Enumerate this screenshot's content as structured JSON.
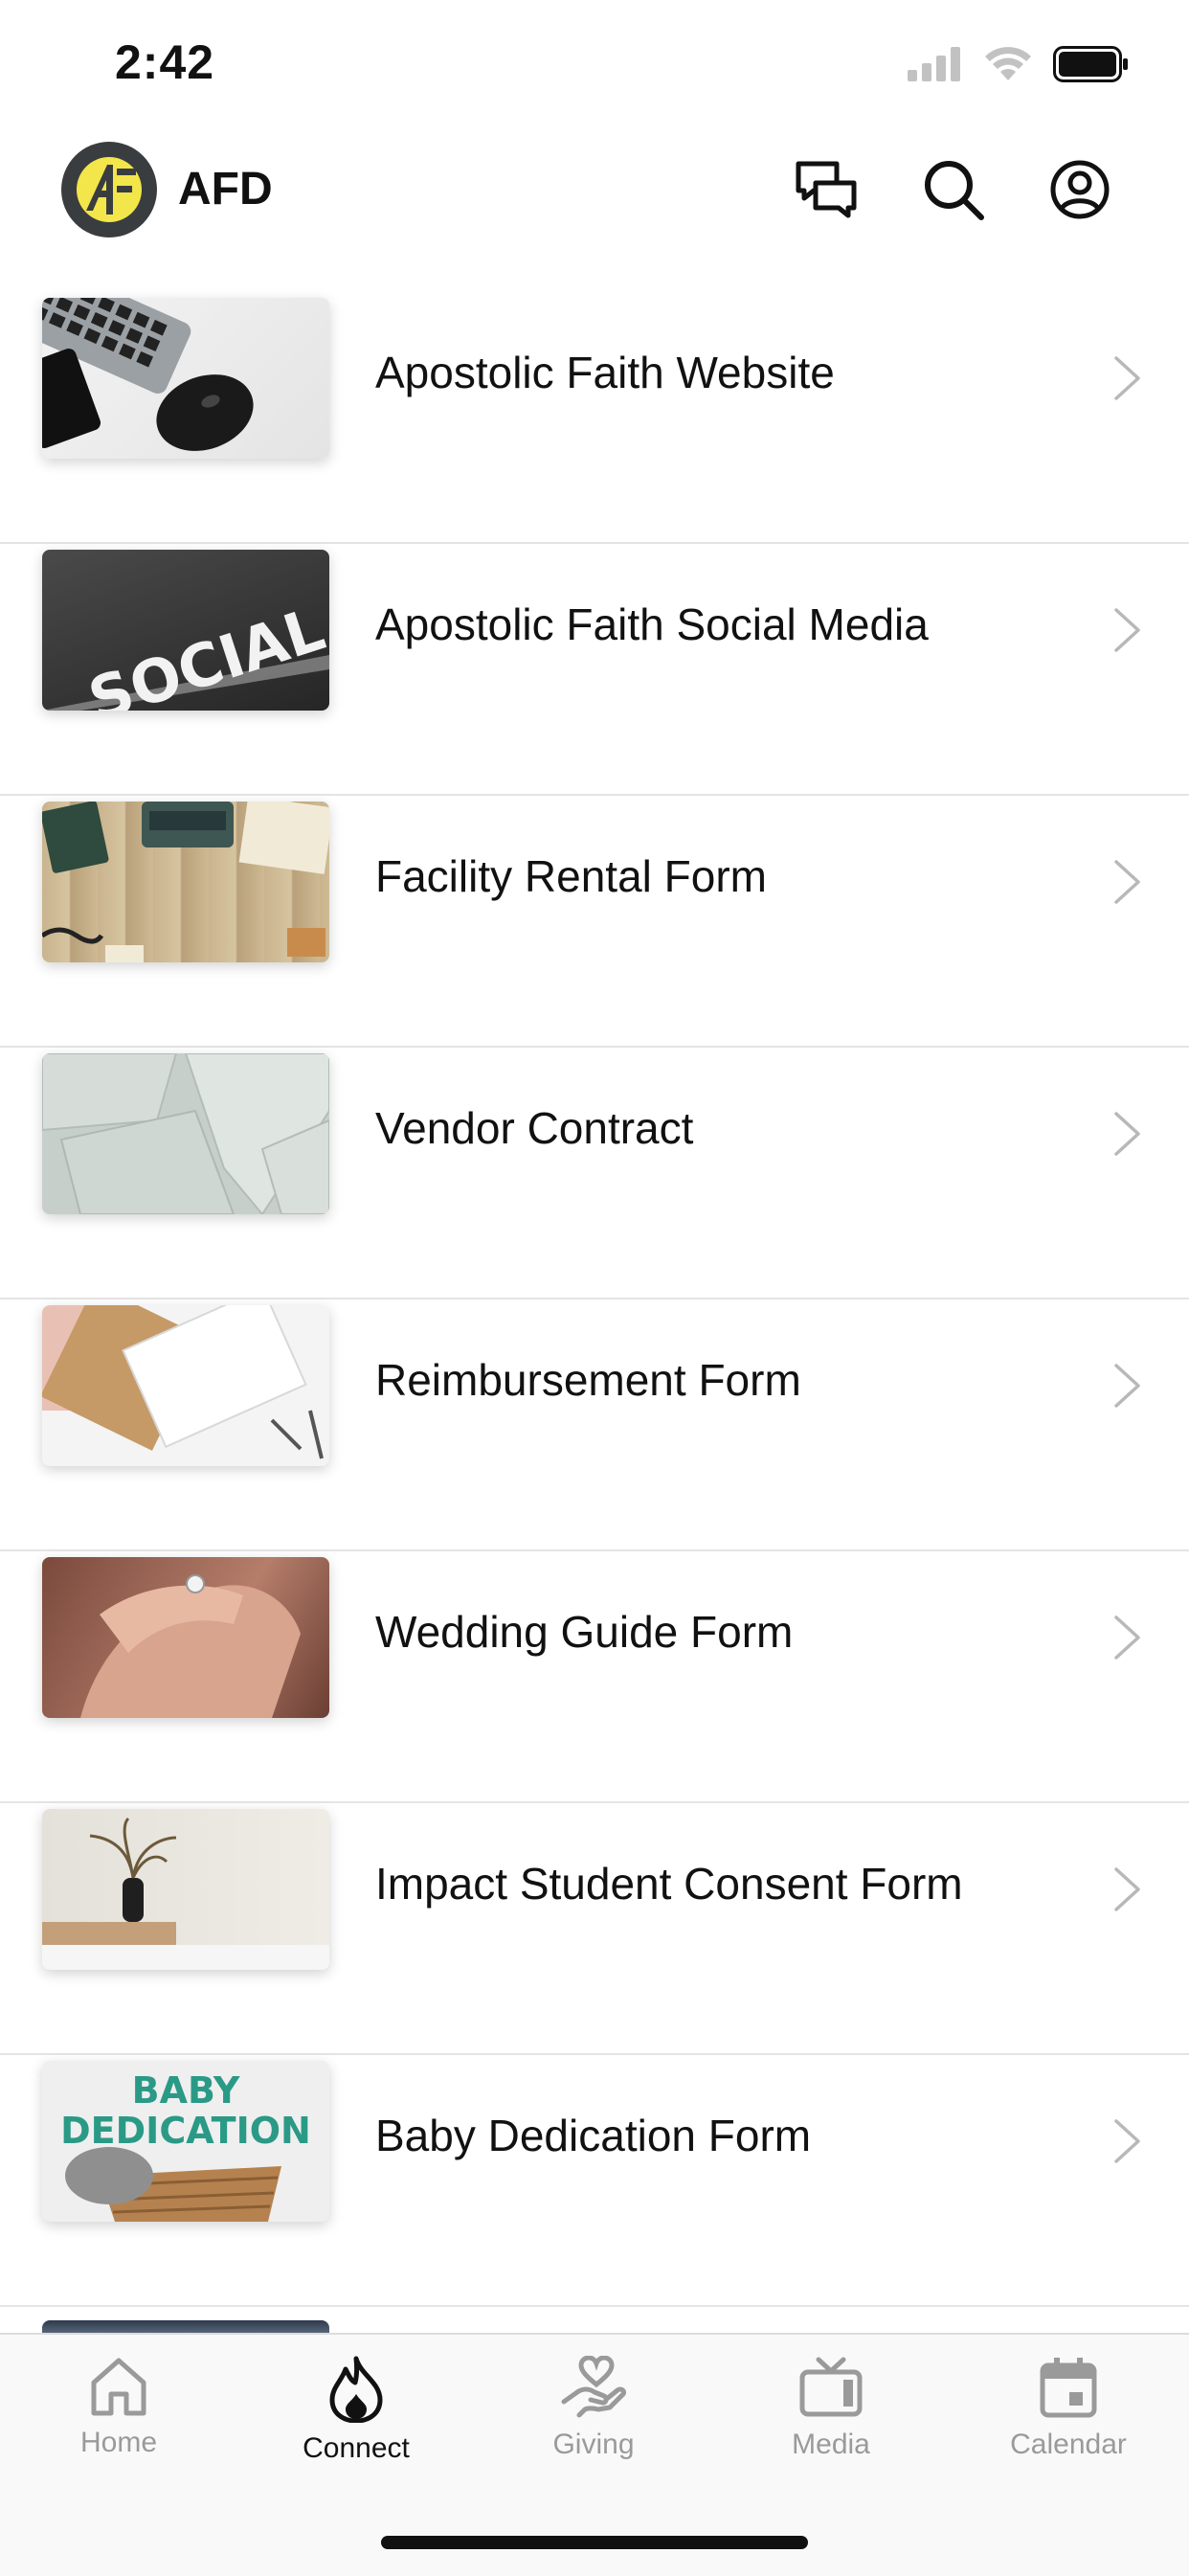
{
  "status_bar": {
    "time": "2:42"
  },
  "header": {
    "title": "AFD",
    "logo_letters": "AF"
  },
  "items": [
    {
      "label": "Apostolic Faith Website",
      "thumb": "desk-keyboard-mouse"
    },
    {
      "label": "Apostolic Faith Social Media",
      "thumb": "social-sign",
      "thumb_text": "SOCIAL"
    },
    {
      "label": "Facility Rental Form",
      "thumb": "typewriter-desk"
    },
    {
      "label": "Vendor Contract",
      "thumb": "paper-stack"
    },
    {
      "label": "Reimbursement Form",
      "thumb": "notepads"
    },
    {
      "label": "Wedding Guide Form",
      "thumb": "hands-ring"
    },
    {
      "label": "Impact Student Consent Form",
      "thumb": "plant-vase"
    },
    {
      "label": "Baby Dedication Form",
      "thumb": "baby-basket",
      "thumb_text_line1": "BABY",
      "thumb_text_line2": "DEDICATION"
    }
  ],
  "tabs": [
    {
      "label": "Home",
      "icon": "home-icon",
      "active": false
    },
    {
      "label": "Connect",
      "icon": "flame-icon",
      "active": true
    },
    {
      "label": "Giving",
      "icon": "giving-hand-heart-icon",
      "active": false
    },
    {
      "label": "Media",
      "icon": "tv-icon",
      "active": false
    },
    {
      "label": "Calendar",
      "icon": "calendar-icon",
      "active": false
    }
  ],
  "colors": {
    "accent": "#111111",
    "inactive": "#9a9a9a",
    "logo_bg": "#3a3d3f",
    "logo_fg": "#f2e64a",
    "baby_text": "#2a9a86"
  }
}
